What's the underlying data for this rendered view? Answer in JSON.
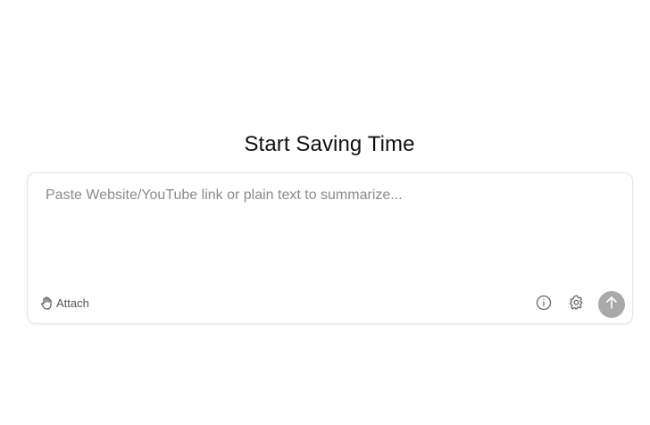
{
  "header": {
    "title": "Start Saving Time"
  },
  "summarize_box": {
    "input_placeholder": "Paste Website/YouTube link or plain text to summarize...",
    "input_value": "",
    "attach_label": "Attach",
    "attach_icon": "hand-pointer-icon",
    "info_icon": "info-icon",
    "settings_icon": "gear-icon",
    "send_icon": "arrow-up-icon"
  },
  "colors": {
    "send_button_bg": "#a9a9a9",
    "border": "#e4e4e4",
    "placeholder": "#8a8a8a"
  }
}
